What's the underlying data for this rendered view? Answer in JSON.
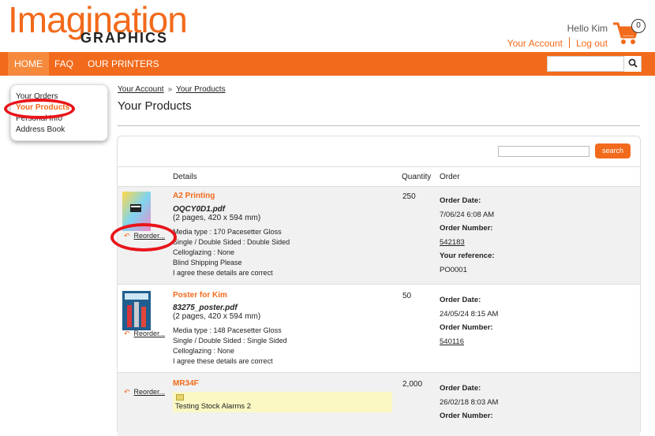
{
  "brand": {
    "main": "Imagination",
    "sub": "GRAPHICS"
  },
  "account": {
    "hello": "Hello Kim",
    "your_account": "Your Account",
    "logout": "Log out",
    "cart_count": "0"
  },
  "nav": {
    "home": "HOME",
    "faq": "FAQ",
    "printers": "OUR PRINTERS"
  },
  "sidebar": {
    "items": [
      {
        "label": "Your Orders"
      },
      {
        "label": "Your Products"
      },
      {
        "label": "Personal Info"
      },
      {
        "label": "Address Book"
      }
    ]
  },
  "breadcrumb": {
    "first": "Your Account",
    "sep": "»",
    "second": "Your Products"
  },
  "page_title": "Your Products",
  "filter": {
    "button": "search"
  },
  "table": {
    "headers": {
      "details": "Details",
      "quantity": "Quantity",
      "order": "Order"
    }
  },
  "rows": [
    {
      "name": "A2 Printing",
      "file": "OQCY0D1.pdf",
      "pages": "(2 pages, 420 x 594 mm)",
      "lines": [
        "Media type : 170 Pacesetter Gloss",
        "Single / Double Sided : Double Sided",
        "Celloglazing : None",
        "Blind Shipping Please",
        "I agree these details are correct"
      ],
      "qty": "250",
      "order_date_label": "Order Date:",
      "order_date": "7/06/24 6:08 AM",
      "order_number_label": "Order Number:",
      "order_number": "542183",
      "ref_label": "Your reference:",
      "ref": "PO0001",
      "reorder": "Reorder..."
    },
    {
      "name": "Poster for Kim",
      "file": "83275_poster.pdf",
      "pages": "(2 pages, 420 x 594 mm)",
      "lines": [
        "Media type : 148 Pacesetter Gloss",
        "Single / Double Sided : Single Sided",
        "Celloglazing : None",
        "I agree these details are correct"
      ],
      "qty": "50",
      "order_date_label": "Order Date:",
      "order_date": "24/05/24 8:15 AM",
      "order_number_label": "Order Number:",
      "order_number": "540116",
      "reorder": "Reorder..."
    },
    {
      "name": "MR34F",
      "note": "Testing Stock Alarms 2",
      "qty": "2,000",
      "order_date_label": "Order Date:",
      "order_date": "26/02/18 8:03 AM",
      "order_number_label": "Order Number:",
      "reorder": "Reorder..."
    }
  ],
  "colors": {
    "brand_orange": "#f26a1b",
    "highlight_red": "#e8141a",
    "note_yellow": "#fbf8c4"
  },
  "icons": [
    "shopping-cart-icon",
    "search-icon",
    "undo-arrow-icon",
    "note-icon"
  ]
}
